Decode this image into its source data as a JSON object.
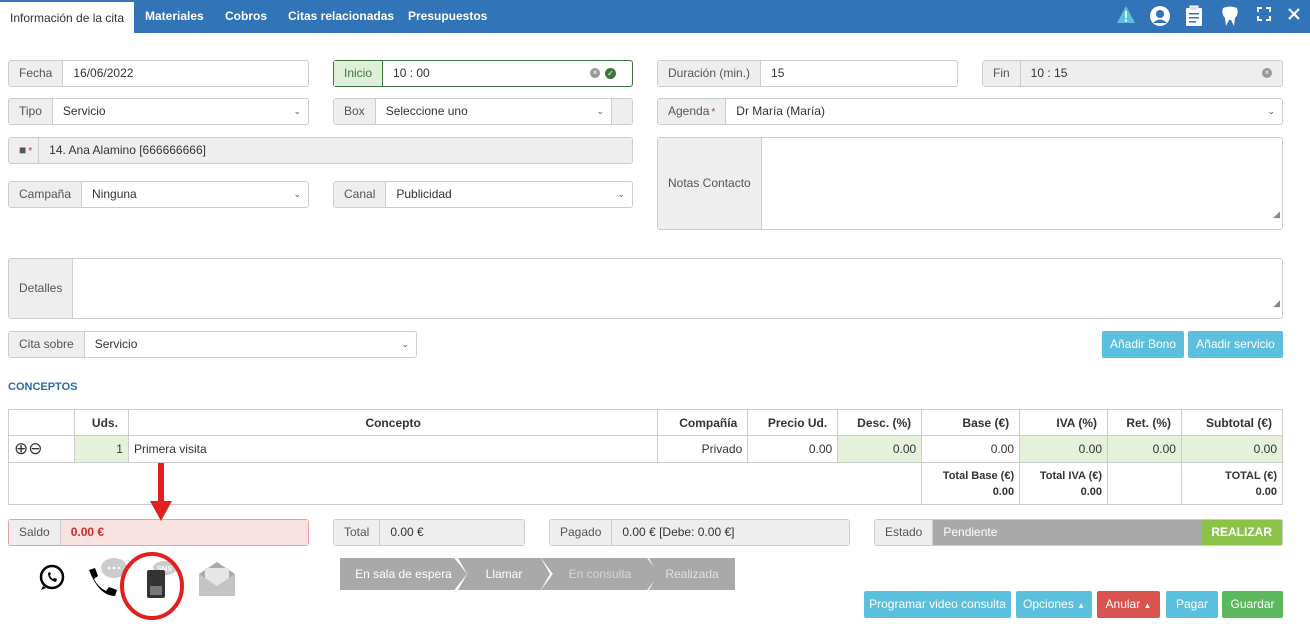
{
  "tabs": [
    "Información de la cita",
    "Materiales",
    "Cobros",
    "Citas relacionadas",
    "Presupuestos"
  ],
  "header_icons": [
    "warning-icon",
    "user-icon",
    "clipboard-icon",
    "tooth-icon",
    "expand-icon",
    "close-icon"
  ],
  "form": {
    "fecha": {
      "label": "Fecha",
      "value": "16/06/2022"
    },
    "inicio": {
      "label": "Inicio",
      "value": "10 : 00"
    },
    "duracion": {
      "label": "Duración (min.)",
      "value": "15"
    },
    "fin": {
      "label": "Fin",
      "value": "10 : 15"
    },
    "tipo": {
      "label": "Tipo",
      "value": "Servicio"
    },
    "box": {
      "label": "Box",
      "value": "Seleccione uno"
    },
    "agenda": {
      "label": "Agenda",
      "value": "Dr María (María)"
    },
    "paciente": {
      "value": "14. Ana Alamino [666666666]"
    },
    "campana": {
      "label": "Campaña",
      "value": "Ninguna"
    },
    "canal": {
      "label": "Canal",
      "value": "Publicidad"
    },
    "notas": {
      "label": "Notas Contacto"
    },
    "detalles": {
      "label": "Detalles"
    },
    "cita_sobre": {
      "label": "Cita sobre",
      "value": "Servicio"
    },
    "required_mark": "*"
  },
  "buttons": {
    "anadir_bono": "Añadir Bono",
    "anadir_servicio": "Añadir servicio",
    "realizar": "REALIZAR",
    "programar": "Programar video consulta",
    "opciones": "Opciones",
    "anular": "Anular",
    "pagar": "Pagar",
    "guardar": "Guardar"
  },
  "conceptos": {
    "title": "CONCEPTOS",
    "headers": [
      "Uds.",
      "Concepto",
      "Compañía",
      "Precio Ud.",
      "Desc. (%)",
      "Base (€)",
      "IVA (%)",
      "Ret. (%)",
      "Subtotal (€)"
    ],
    "row": [
      "1",
      "Primera visita",
      "Privado",
      "0.00",
      "0.00",
      "0.00",
      "0.00",
      "0.00",
      "0.00"
    ],
    "totals": {
      "base_label": "Total Base (€)",
      "base": "0.00",
      "iva_label": "Total IVA (€)",
      "iva": "0.00",
      "total_label": "TOTAL (€)",
      "total": "0.00"
    }
  },
  "summary": {
    "saldo": {
      "label": "Saldo",
      "value": "0.00 €"
    },
    "total": {
      "label": "Total",
      "value": "0.00 €"
    },
    "pagado": {
      "label": "Pagado",
      "value": "0.00 € [Debe: 0.00 €]"
    },
    "estado": {
      "label": "Estado",
      "value": "Pendiente"
    }
  },
  "steps": [
    "En sala de espera",
    "Llamar",
    "En consulta",
    "Realizada"
  ],
  "sms_text": "SMS",
  "colors": {
    "primary": "#3174b7",
    "info": "#5bc0de",
    "danger": "#d9534f",
    "success": "#5cb85c",
    "realizar": "#8bc34a",
    "saldo_bg": "#f8e1e1",
    "saldo_text": "#c9302c",
    "annotation": "#e32020"
  }
}
